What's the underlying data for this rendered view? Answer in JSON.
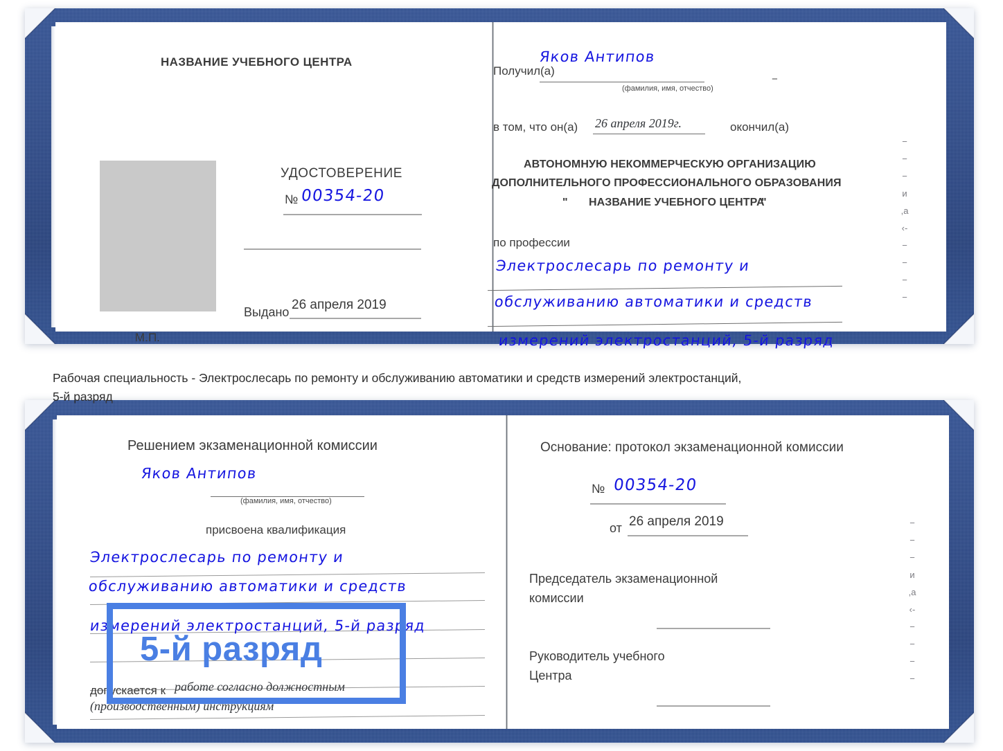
{
  "document": {
    "type": "Russian vocational qualification certificate (удостоверение), opened book, two spreads",
    "caption": "Рабочая специальность - Электрослесарь по ремонту и обслуживанию автоматики и средств измерений электростанций, 5-й разряд"
  },
  "colors": {
    "cover_blue": "#27468a",
    "ink_blue": "#1616e0",
    "annotation_blue": "#4a7fe3",
    "photo_placeholder_gray": "#c9c9c9",
    "rule_gray": "#9a9a9a",
    "text_gray": "#3a3a3a"
  },
  "top_spread": {
    "left_page": {
      "header": "НАЗВАНИЕ УЧЕБНОГО ЦЕНТРА",
      "doc_title": "УДОСТОВЕРЕНИЕ",
      "number_symbol": "№",
      "number_value": "00354-20",
      "issued_label": "Выдано",
      "issued_value": "26 апреля 2019",
      "seal_label": "М.П.",
      "photo_placeholder": "photo-area"
    },
    "right_page": {
      "received_label": "Получил(а)",
      "received_value": "Яков Антипов",
      "name_hint": "(фамилия, имя, отчество)",
      "in_that_label": "в том, что он(а)",
      "date_value": "26 апреля 2019г.",
      "finished_label": "окончил(а)",
      "org_line1": "АВТОНОМНУЮ НЕКОММЕРЧЕСКУЮ ОРГАНИЗАЦИЮ",
      "org_line2": "ДОПОЛНИТЕЛЬНОГО ПРОФЕССИОНАЛЬНОГО ОБРАЗОВАНИЯ",
      "org_quote_open": "\"",
      "org_line3": "НАЗВАНИЕ УЧЕБНОГО ЦЕНТРА",
      "org_quote_close": "\"",
      "profession_label": "по профессии",
      "profession_line1": "Электрослесарь по ремонту и",
      "profession_line2": "обслуживанию автоматики и средств",
      "profession_line3": "измерений электростанций, 5-й разряд",
      "bleed_column": "−\n−\n−\nи\n,а\n‹-\n−\n−\n−\n−"
    }
  },
  "bottom_spread": {
    "left_page": {
      "header": "Решением экзаменационной комиссии",
      "name_value": "Яков Антипов",
      "name_hint": "(фамилия, имя, отчество)",
      "qualification_label": "присвоена квалификация",
      "qual_line1": "Электрослесарь по ремонту и",
      "qual_line2": "обслуживанию автоматики и средств",
      "qual_line3": "измерений электростанций, 5-й разряд",
      "admitted_label": "допускается к",
      "admitted_value1": "работе согласно должностным",
      "admitted_value2": "(производственным) инструкциям"
    },
    "right_page": {
      "basis_label": "Основание: протокол экзаменационной комиссии",
      "number_symbol": "№",
      "number_value": "00354-20",
      "from_label": "от",
      "from_value": "26 апреля 2019",
      "chairman_line1": "Председатель экзаменационной",
      "chairman_line2": "комиссии",
      "director_line1": "Руководитель учебного",
      "director_line2": "Центра",
      "bleed_column": "−\n−\n−\nи\n,а\n‹-\n−\n−\n−\n−"
    }
  },
  "annotation": {
    "label": "5-й разряд",
    "box_color": "#4a7fe3"
  }
}
